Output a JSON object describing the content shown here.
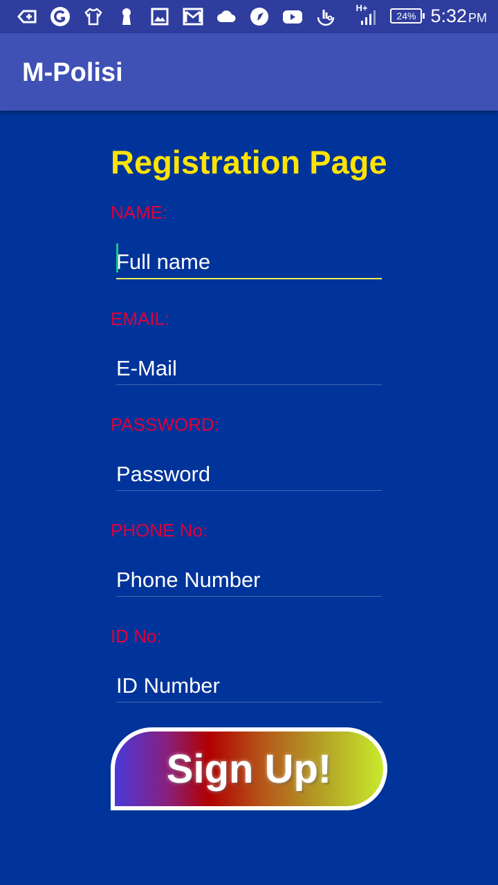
{
  "status_bar": {
    "icons": [
      "back-in-icon",
      "refresh-circle-icon",
      "shirt-icon",
      "keyhole-icon",
      "image-icon",
      "gmail-icon",
      "cloud-icon",
      "compass-icon",
      "youtube-icon",
      "touch-icon"
    ],
    "network_type": "H+",
    "battery": "24%",
    "time": "5:32",
    "ampm": "PM"
  },
  "app_bar": {
    "title": "M-Polisi"
  },
  "form": {
    "title": "Registration Page",
    "name_label": "NAME:",
    "name_placeholder": "Full name",
    "email_label": "EMAIL:",
    "email_placeholder": "E-Mail",
    "password_label": "PASSWORD:",
    "password_placeholder": "Password",
    "phone_label": "PHONE No:",
    "phone_placeholder": "Phone Number",
    "id_label": "ID No:",
    "id_placeholder": "ID Number",
    "signup_label": "Sign Up!"
  },
  "colors": {
    "background": "#00349a",
    "app_bar": "#3f51b5",
    "title": "#ffe400",
    "label": "#e0003b"
  }
}
